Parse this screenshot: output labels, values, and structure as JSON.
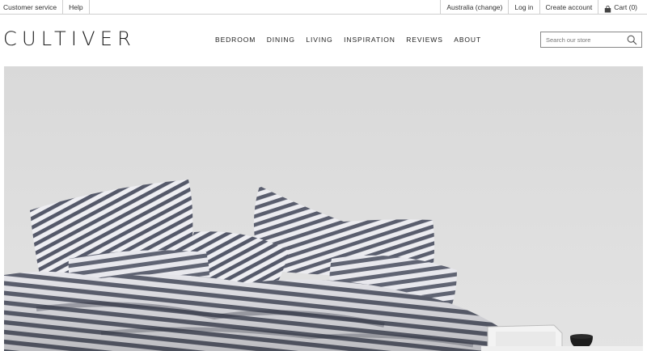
{
  "utility_bar": {
    "left_links": [
      "Customer service",
      "Help"
    ],
    "region": "Australia (change)",
    "login": "Log in",
    "create_account": "Create account",
    "cart": "Cart (0)",
    "cart_icon": "shopping-bag-icon"
  },
  "header": {
    "logo": "CULTIVER",
    "nav": [
      "BEDROOM",
      "DINING",
      "LIVING",
      "INSPIRATION",
      "REVIEWS",
      "ABOUT"
    ],
    "search": {
      "placeholder": "Search our store",
      "icon": "search-icon"
    }
  },
  "hero": {
    "image": "striped-linen-bedding-photo"
  },
  "colors": {
    "text": "#222222",
    "border": "#cfcfcf",
    "stripe_dark": "#55596a",
    "stripe_light": "#eeeef2"
  }
}
